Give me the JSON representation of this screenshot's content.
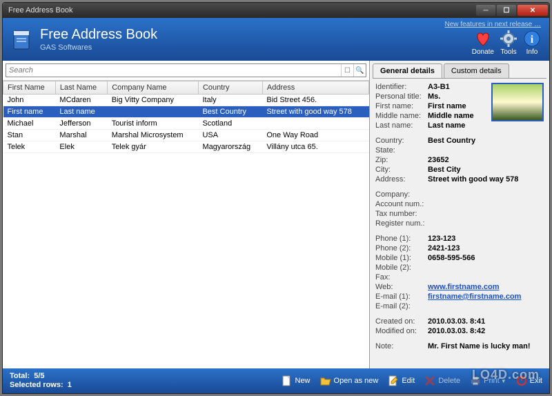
{
  "window": {
    "title": "Free Address Book"
  },
  "header": {
    "app_title": "Free Address Book",
    "subtitle": "GAS Softwares",
    "new_features": "New features in next release …",
    "buttons": {
      "donate": "Donate",
      "tools": "Tools",
      "info": "Info"
    }
  },
  "search": {
    "placeholder": "Search"
  },
  "table": {
    "columns": [
      "First Name",
      "Last Name",
      "Company Name",
      "Country",
      "Address"
    ],
    "rows": [
      {
        "first": "John",
        "last": "MCdaren",
        "company": "Big Vitty Company",
        "country": "Italy",
        "address": "Bid Street 456.",
        "selected": false
      },
      {
        "first": "First name",
        "last": "Last name",
        "company": "",
        "country": "Best Country",
        "address": "Street with good way 578",
        "selected": true
      },
      {
        "first": "Michael",
        "last": "Jefferson",
        "company": "Tourist inform",
        "country": "Scotland",
        "address": "",
        "selected": false
      },
      {
        "first": "Stan",
        "last": "Marshal",
        "company": "Marshal Microsystem",
        "country": "USA",
        "address": "One Way Road",
        "selected": false
      },
      {
        "first": "Telek",
        "last": "Elek",
        "company": "Telek gyár",
        "country": "Magyarország",
        "address": "Villány utca 65.",
        "selected": false
      }
    ]
  },
  "details": {
    "tabs": {
      "general": "General details",
      "custom": "Custom details"
    },
    "labels": {
      "identifier": "Identifier:",
      "personal_title": "Personal title:",
      "first_name": "First name:",
      "middle_name": "Middle name:",
      "last_name": "Last name:",
      "country": "Country:",
      "state": "State:",
      "zip": "Zip:",
      "city": "City:",
      "address": "Address:",
      "company": "Company:",
      "account_num": "Account num.:",
      "tax_number": "Tax number:",
      "register_num": "Register num.:",
      "phone1": "Phone (1):",
      "phone2": "Phone (2):",
      "mobile1": "Mobile (1):",
      "mobile2": "Mobile (2):",
      "fax": "Fax:",
      "web": "Web:",
      "email1": "E-mail (1):",
      "email2": "E-mail (2):",
      "created": "Created on:",
      "modified": "Modified on:",
      "note": "Note:"
    },
    "values": {
      "identifier": "A3-B1",
      "personal_title": "Ms.",
      "first_name": "First name",
      "middle_name": "Middle name",
      "last_name": "Last name",
      "country": "Best Country",
      "state": "",
      "zip": "23652",
      "city": "Best City",
      "address": "Street with good way 578",
      "company": "",
      "account_num": "",
      "tax_number": "",
      "register_num": "",
      "phone1": "123-123",
      "phone2": "2421-123",
      "mobile1": "0658-595-566",
      "mobile2": "",
      "fax": "",
      "web": "www.firstname.com",
      "email1": "firstname@firstname.com",
      "email2": "",
      "created": "2010.03.03. 8:41",
      "modified": "2010.03.03. 8:42",
      "note": "Mr. First Name is lucky man!"
    }
  },
  "footer": {
    "total_label": "Total:",
    "total_value": "5/5",
    "selected_label": "Selected rows:",
    "selected_value": "1",
    "buttons": {
      "new": "New",
      "open_as_new": "Open as new",
      "edit": "Edit",
      "delete": "Delete",
      "print": "Print",
      "exit": "Exit"
    }
  },
  "watermark": "LO4D.com"
}
